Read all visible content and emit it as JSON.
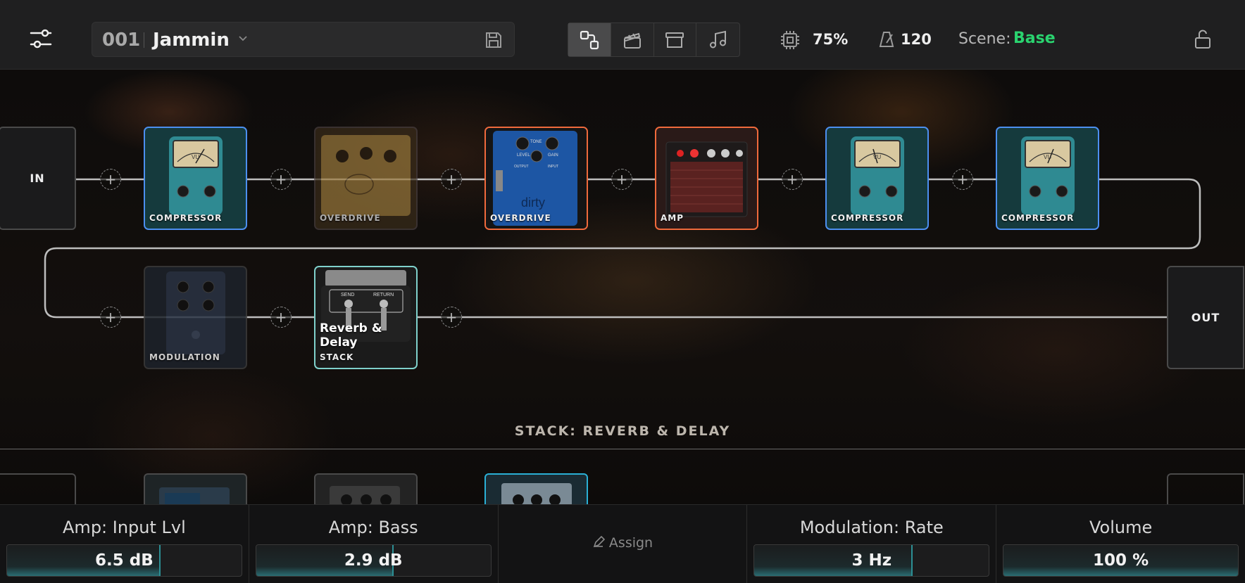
{
  "topbar": {
    "preset_number": "001",
    "preset_name": "Jammin",
    "cpu": "75%",
    "tempo": "120",
    "scene_label": "Scene:",
    "scene_value": "Base",
    "view_buttons": [
      "routing-icon",
      "scenes-icon",
      "archive-icon",
      "music-icon"
    ]
  },
  "chain": {
    "input_label": "IN",
    "output_label": "OUT",
    "blocks": [
      {
        "label": "COMPRESSOR",
        "state": "active"
      },
      {
        "label": "OVERDRIVE",
        "state": "bypassed"
      },
      {
        "label": "OVERDRIVE",
        "state": "selected"
      },
      {
        "label": "AMP",
        "state": "active"
      },
      {
        "label": "COMPRESSOR",
        "state": "active"
      },
      {
        "label": "COMPRESSOR",
        "state": "active"
      },
      {
        "label": "MODULATION",
        "state": "bypassed"
      },
      {
        "label": "STACK",
        "title": "Reverb & Delay",
        "state": "active"
      }
    ],
    "pedal_text": {
      "vu": "VU",
      "tone": "TONE",
      "level": "LEVEL",
      "gain": "GAIN",
      "output": "OUTPUT",
      "input": "INPUT",
      "dirty": "dirty",
      "send": "SEND",
      "return": "RETURN"
    }
  },
  "stack": {
    "title": "STACK: REVERB & DELAY"
  },
  "bottom": {
    "knobs": [
      {
        "title": "Amp: Input Lvl",
        "value": "6.5 dB",
        "fill": 0.65
      },
      {
        "title": "Amp: Bass",
        "value": "2.9 dB",
        "fill": 0.58
      },
      {
        "title": "Modulation: Rate",
        "value": "3 Hz",
        "fill": 0.67
      },
      {
        "title": "Volume",
        "value": "100 %",
        "fill": 1.0
      }
    ],
    "assign_label": "Assign"
  },
  "colors": {
    "compressor_border": "#4c8ff0",
    "selected_border": "#f06a3c",
    "stack_border": "#7fd1cc",
    "scene_accent": "#2ad36f"
  }
}
